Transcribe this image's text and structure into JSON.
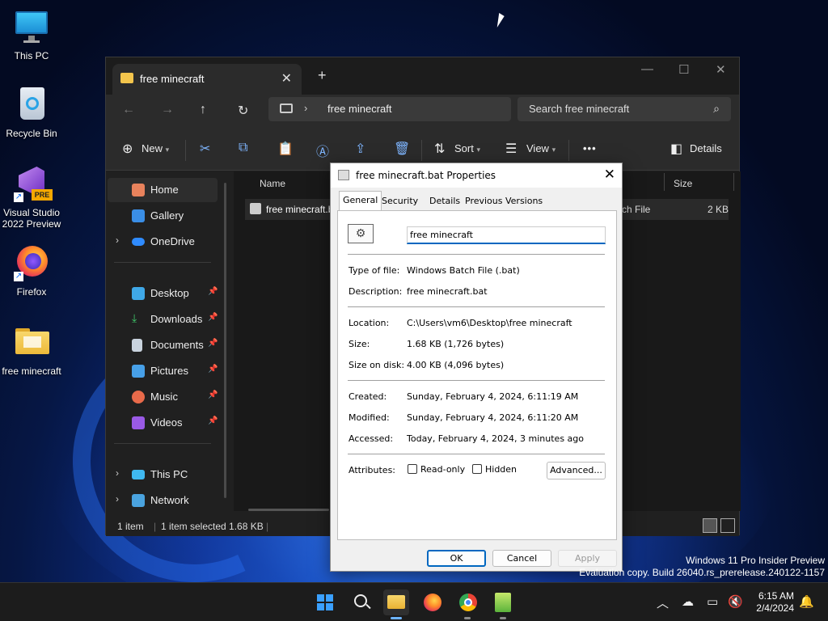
{
  "desktop": {
    "icons": [
      {
        "label": "This PC"
      },
      {
        "label": "Recycle Bin"
      },
      {
        "label": "Visual Studio 2022 Preview",
        "badge": "PRE"
      },
      {
        "label": "Firefox"
      },
      {
        "label": "free minecraft"
      }
    ],
    "watermark_line1": "Windows 11 Pro Insider Preview",
    "watermark_line2": "Evaluation copy. Build 26040.rs_prerelease.240122-1157"
  },
  "explorer": {
    "tab_title": "free minecraft",
    "new_tab": "+",
    "address_path": "free minecraft",
    "address_sep": "›",
    "search_placeholder": "Search free minecraft",
    "commands": {
      "new": "New",
      "sort": "Sort",
      "view": "View",
      "details": "Details",
      "more": "•••"
    },
    "nav": [
      {
        "label": "Home",
        "selected": true
      },
      {
        "label": "Gallery"
      },
      {
        "label": "OneDrive",
        "expandable": true
      },
      {
        "label": "Desktop",
        "pinned": true
      },
      {
        "label": "Downloads",
        "pinned": true
      },
      {
        "label": "Documents",
        "pinned": true
      },
      {
        "label": "Pictures",
        "pinned": true
      },
      {
        "label": "Music",
        "pinned": true
      },
      {
        "label": "Videos",
        "pinned": true
      },
      {
        "label": "This PC",
        "expandable": true
      },
      {
        "label": "Network",
        "expandable": true
      }
    ],
    "columns": {
      "name": "Name",
      "size": "Size"
    },
    "file": {
      "name": "free minecraft.b",
      "type": "atch File",
      "size": "2 KB"
    },
    "status": {
      "count": "1 item",
      "selected": "1 item selected  1.68 KB"
    }
  },
  "dialog": {
    "title": "free minecraft.bat Properties",
    "tabs": [
      "General",
      "Security",
      "Details",
      "Previous Versions"
    ],
    "active_tab": "General",
    "file_name": "free minecraft",
    "type_of_file_label": "Type of file:",
    "type_of_file": "Windows Batch File (.bat)",
    "description_label": "Description:",
    "description": "free minecraft.bat",
    "location_label": "Location:",
    "location": "C:\\Users\\vm6\\Desktop\\free minecraft",
    "size_label": "Size:",
    "size": "1.68 KB (1,726 bytes)",
    "size_on_disk_label": "Size on disk:",
    "size_on_disk": "4.00 KB (4,096 bytes)",
    "created_label": "Created:",
    "created": "Sunday, February 4, 2024, 6:11:19 AM",
    "modified_label": "Modified:",
    "modified": "Sunday, February 4, 2024, 6:11:20 AM",
    "accessed_label": "Accessed:",
    "accessed": "Today, February 4, 2024, 3 minutes ago",
    "attributes_label": "Attributes:",
    "readonly_label": "Read-only",
    "hidden_label": "Hidden",
    "advanced_label": "Advanced...",
    "ok_label": "OK",
    "cancel_label": "Cancel",
    "apply_label": "Apply"
  },
  "taskbar": {
    "time": "6:15 AM",
    "date": "2/4/2024"
  },
  "colors": {
    "accent": "#0067c0",
    "folder": "#f3c54c",
    "explorer_bg": "#202020"
  }
}
